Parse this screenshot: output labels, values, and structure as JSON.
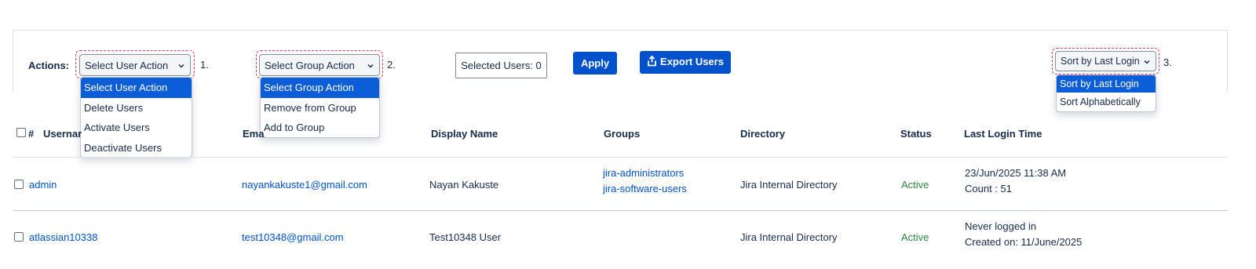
{
  "toolbar": {
    "actions_label": "Actions:",
    "user_action_value": "Select User Action",
    "group_action_value": "Select Group Action",
    "sort_value": "Sort by Last Login",
    "step_1": "1.",
    "step_2": "2.",
    "step_3": "3.",
    "selected_users": "Selected Users: 0",
    "apply_label": "Apply",
    "export_label": "Export Users"
  },
  "user_action_menu": {
    "options": [
      "Select User Action",
      "Delete Users",
      "Activate Users",
      "Deactivate Users"
    ],
    "selected": "Select User Action"
  },
  "group_action_menu": {
    "options": [
      "Select Group Action",
      "Remove from Group",
      "Add to Group"
    ],
    "selected": "Select Group Action"
  },
  "sort_menu": {
    "options": [
      "Sort by Last Login",
      "Sort Alphabetically"
    ],
    "selected": "Sort by Last Login"
  },
  "table": {
    "headers": {
      "hash": "#",
      "username": "Usernar",
      "email": "Ema",
      "display_name": "Display Name",
      "groups": "Groups",
      "directory": "Directory",
      "status": "Status",
      "last_login": "Last Login Time"
    },
    "rows": [
      {
        "username": "admin",
        "email": "nayankakuste1@gmail.com",
        "display_name": "Nayan Kakuste",
        "groups": [
          "jira-administrators",
          "jira-software-users"
        ],
        "directory": "Jira Internal Directory",
        "status": "Active",
        "last_login_line1": "23/Jun/2025 11:38 AM",
        "last_login_line2": "Count : 51"
      },
      {
        "username": "atlassian10338",
        "email": "test10348@gmail.com",
        "display_name": "Test10348 User",
        "groups": [],
        "directory": "Jira Internal Directory",
        "status": "Active",
        "last_login_line1": "Never logged in",
        "last_login_line2": "Created on: 11/June/2025"
      }
    ]
  },
  "colors": {
    "primary_button": "#0052cc",
    "highlight_option": "#0b5ed7",
    "link": "#0052cc",
    "status_active": "#2e8540",
    "annotation_dash": "#e03d5a"
  }
}
